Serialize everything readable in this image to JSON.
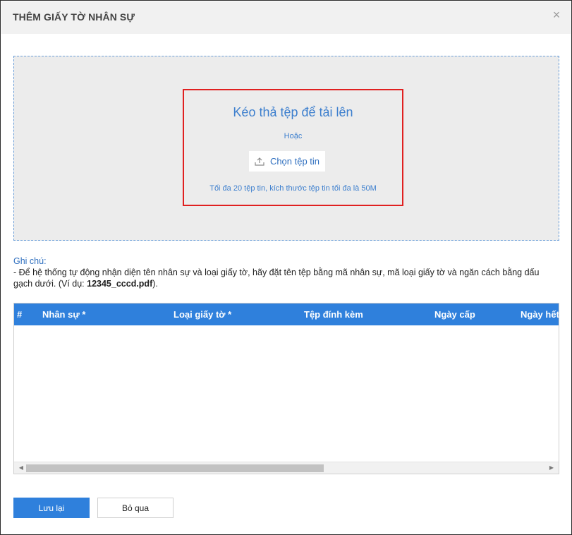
{
  "dialog": {
    "title": "THÊM GIẤY TỜ NHÂN SỰ",
    "close_icon": "×"
  },
  "dropzone": {
    "title": "Kéo thả tệp để tải lên",
    "or_text": "Hoặc",
    "choose_button": "Chọn tệp tin",
    "upload_icon": "upload-icon",
    "limit_text": "Tối đa 20 tệp tin, kích thước tệp tin tối đa là 50M",
    "highlight_color": "#e02020",
    "accent_color": "#3d7fce"
  },
  "note": {
    "title": "Ghi chú:",
    "text_before": "- Để hệ thống tự động nhận diện tên nhân sự và loại giấy tờ, hãy đặt tên tệp bằng mã nhân sự, mã loại giấy tờ và ngăn cách bằng dấu gạch dưới. (Ví dụ: ",
    "example": "12345_cccd.pdf",
    "text_after": ")."
  },
  "table": {
    "header_color": "#2f80dc",
    "columns": [
      "#",
      "Nhân sự *",
      "Loại giấy tờ *",
      "Tệp đính kèm",
      "Ngày cấp",
      "Ngày hết"
    ],
    "rows": [],
    "scroll_left_icon": "◀",
    "scroll_right_icon": "▶"
  },
  "footer": {
    "save_label": "Lưu lại",
    "skip_label": "Bỏ qua"
  }
}
